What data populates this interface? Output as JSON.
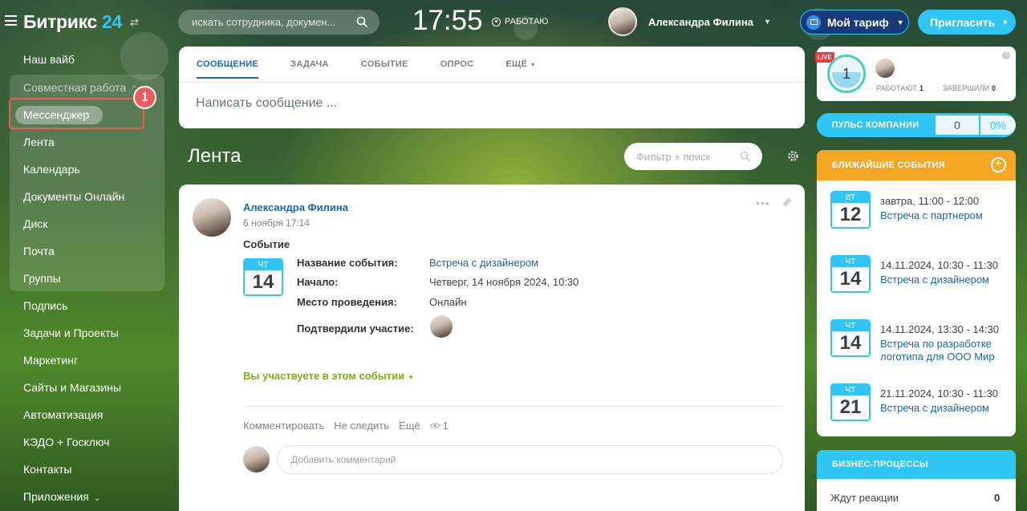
{
  "header": {
    "logo_text": "Битрикс",
    "logo_num": "24",
    "search_placeholder": "искать сотрудника, докумен...",
    "clock": "17:55",
    "work_status": "РАБОТАЮ",
    "user_name": "Александра Филина",
    "tariff_label": "Мой тариф",
    "invite_label": "Пригласить"
  },
  "sidebar": {
    "items": [
      {
        "label": "Наш вайб"
      },
      {
        "label": "Совместная работа"
      },
      {
        "label": "Мессенджер"
      },
      {
        "label": "Лента"
      },
      {
        "label": "Календарь"
      },
      {
        "label": "Документы Онлайн"
      },
      {
        "label": "Диск"
      },
      {
        "label": "Почта"
      },
      {
        "label": "Группы"
      },
      {
        "label": "Подпись"
      },
      {
        "label": "Задачи и Проекты"
      },
      {
        "label": "Маркетинг"
      },
      {
        "label": "Сайты и Магазины"
      },
      {
        "label": "Автоматизация"
      },
      {
        "label": "КЭДО + Госключ"
      },
      {
        "label": "Контакты"
      },
      {
        "label": "Приложения"
      }
    ],
    "highlight_badge": "1"
  },
  "composer": {
    "tabs": [
      "СООБЩЕНИЕ",
      "ЗАДАЧА",
      "СОБЫТИЕ",
      "ОПРОС",
      "ЕЩЁ"
    ],
    "placeholder": "Написать сообщение ..."
  },
  "feed": {
    "title": "Лента",
    "filter_placeholder": "Фильтр + поиск"
  },
  "post": {
    "author": "Александра Филина",
    "date": "6 ноября 17:14",
    "kind": "Событие",
    "calendar": {
      "dow": "ЧТ",
      "day": "14"
    },
    "fields": [
      {
        "label": "Название события:",
        "value": "Встреча с дизайнером"
      },
      {
        "label": "Начало:",
        "value": "Четверг, 14 ноября 2024, 10:30"
      },
      {
        "label": "Место проведения:",
        "value": "Онлайн"
      },
      {
        "label": "Подтвердили участие:",
        "value": ""
      }
    ],
    "participate": "Вы участвуете в этом событии",
    "actions": {
      "comment": "Комментировать",
      "unfollow": "Не следить",
      "more": "Ещё",
      "views": "1"
    },
    "comment_placeholder": "Добавить комментарий"
  },
  "live": {
    "badge": "LIVE",
    "count": "1",
    "working_label": "РАБОТАЮТ",
    "working_count": "1",
    "done_label": "ЗАВЕРШИЛИ",
    "done_count": "0",
    "help": "?"
  },
  "pulse": {
    "label": "ПУЛЬС КОМПАНИИ",
    "value": "0",
    "percent": "0%"
  },
  "events": {
    "title": "БЛИЖАЙШИЕ СОБЫТИЯ",
    "items": [
      {
        "dow": "ВТ",
        "day": "12",
        "time": "завтра, 11:00 - 12:00",
        "title": "Встреча с партнером"
      },
      {
        "dow": "ЧТ",
        "day": "14",
        "time": "14.11.2024, 10:30 - 11:30",
        "title": "Встреча с дизайнером"
      },
      {
        "dow": "ЧТ",
        "day": "14",
        "time": "14.11.2024, 13:30 - 14:30",
        "title": "Встреча по разработке логотипа для ООО Мир"
      },
      {
        "dow": "ЧТ",
        "day": "21",
        "time": "21.11.2024, 10:30 - 11:30",
        "title": "Встреча с дизайнером"
      }
    ]
  },
  "business_processes": {
    "title": "БИЗНЕС-ПРОЦЕССЫ",
    "row_label": "Ждут реакции",
    "row_count": "0"
  },
  "colors": {
    "accent": "#2fc6f6",
    "link": "#2067b0",
    "orange": "#f5a623",
    "highlight": "#f05a5a",
    "green": "#7aae19"
  }
}
